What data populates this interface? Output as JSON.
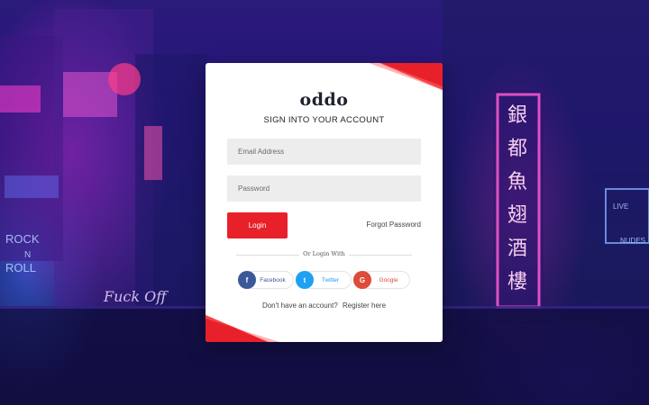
{
  "brand": {
    "logo": "oddo",
    "subtitle": "SIGN INTO YOUR ACCOUNT",
    "accent": "#e8202a"
  },
  "form": {
    "email_placeholder": "Email Address",
    "password_placeholder": "Password",
    "login_label": "Login",
    "forgot_label": "Forgot Password"
  },
  "divider": {
    "label": "Or Login With"
  },
  "social": [
    {
      "label": "Facebook",
      "icon": "facebook-icon",
      "glyph": "f",
      "color": "#3b5998"
    },
    {
      "label": "Twitter",
      "icon": "twitter-icon",
      "glyph": "t",
      "color": "#1da1f2"
    },
    {
      "label": "Google",
      "icon": "google-icon",
      "glyph": "G",
      "color": "#dd4b39"
    }
  ],
  "register": {
    "prompt": "Don't have an account?",
    "link_label": "Register here"
  },
  "background": {
    "signs": [
      "ROCK",
      "N",
      "ROLL",
      "Fuck Off",
      "銀",
      "都",
      "魚",
      "翅",
      "酒",
      "樓",
      "LIVE",
      "NUDES"
    ]
  }
}
